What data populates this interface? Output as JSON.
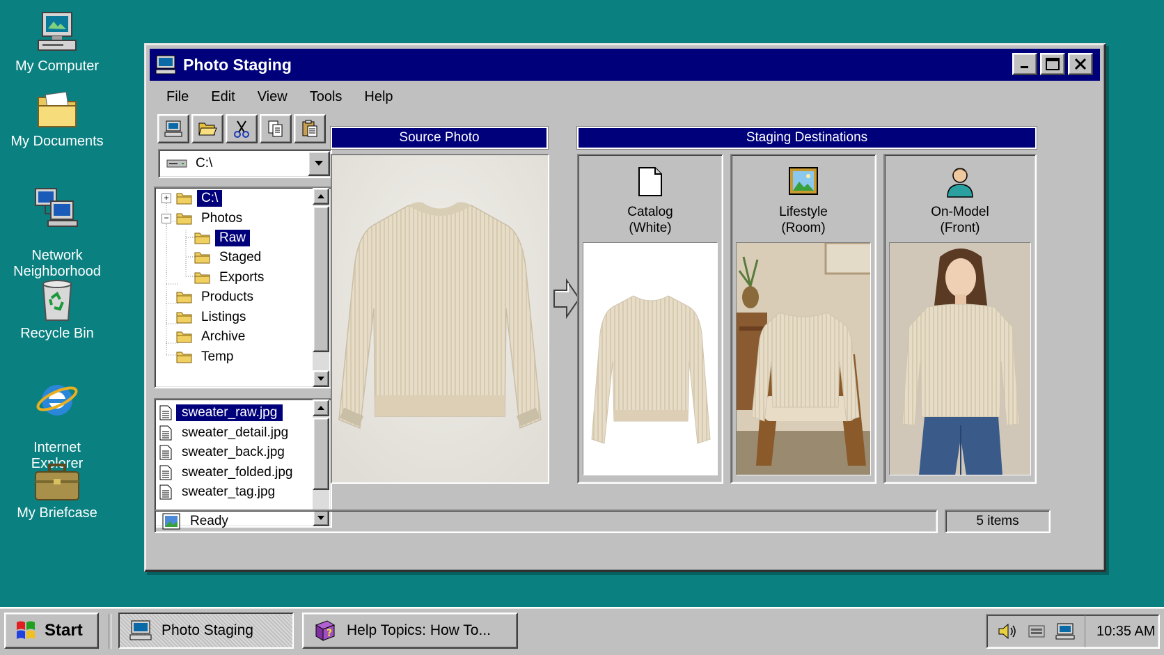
{
  "desktop": {
    "icons": [
      {
        "id": "my-computer",
        "label": "My Computer"
      },
      {
        "id": "my-documents",
        "label": "My Documents"
      },
      {
        "id": "network",
        "label": "Network\nNeighborhood"
      },
      {
        "id": "recycle-bin",
        "label": "Recycle Bin"
      },
      {
        "id": "internet-explorer",
        "label": "Internet\nExplorer"
      },
      {
        "id": "my-briefcase",
        "label": "My Briefcase"
      }
    ]
  },
  "window": {
    "title": "Photo Staging",
    "menu": [
      "File",
      "Edit",
      "View",
      "Tools",
      "Help"
    ],
    "toolbar": [
      {
        "icon": "computer-icon"
      },
      {
        "icon": "open-folder-icon"
      },
      {
        "icon": "cut-icon"
      },
      {
        "icon": "copy-icon"
      },
      {
        "icon": "paste-icon"
      }
    ],
    "drive": {
      "value": "C:\\"
    },
    "tree": [
      {
        "label": "C:\\",
        "level": 0,
        "expander": "+",
        "selected": true
      },
      {
        "label": "Photos",
        "level": 0,
        "expander": "-",
        "selected": false
      },
      {
        "label": "Raw",
        "level": 1,
        "expander": "",
        "selected": true
      },
      {
        "label": "Staged",
        "level": 1,
        "expander": "",
        "selected": false
      },
      {
        "label": "Exports",
        "level": 1,
        "expander": "",
        "selected": false
      },
      {
        "label": "Products",
        "level": 0,
        "expander": "",
        "selected": false
      },
      {
        "label": "Listings",
        "level": 0,
        "expander": "",
        "selected": false
      },
      {
        "label": "Archive",
        "level": 0,
        "expander": "",
        "selected": false
      },
      {
        "label": "Temp",
        "level": 0,
        "expander": "",
        "selected": false
      }
    ],
    "files": [
      {
        "name": "sweater_raw.jpg",
        "selected": true
      },
      {
        "name": "sweater_detail.jpg",
        "selected": false
      },
      {
        "name": "sweater_back.jpg",
        "selected": false
      },
      {
        "name": "sweater_folded.jpg",
        "selected": false
      },
      {
        "name": "sweater_tag.jpg",
        "selected": false
      }
    ],
    "source_header": "Source Photo",
    "destinations_header": "Staging Destinations",
    "destinations": [
      {
        "icon": "blank-page-icon",
        "line1": "Catalog",
        "line2": "(White)"
      },
      {
        "icon": "landscape-picture-icon",
        "line1": "Lifestyle",
        "line2": "(Room)"
      },
      {
        "icon": "person-icon",
        "line1": "On-Model",
        "line2": "(Front)"
      }
    ],
    "status": {
      "text": "Ready",
      "count": "5 items"
    }
  },
  "taskbar": {
    "start_label": "Start",
    "tasks": [
      {
        "label": "Photo Staging",
        "active": true
      },
      {
        "label": "Help Topics: How To...",
        "active": false
      }
    ],
    "clock": "10:35 AM"
  },
  "colors": {
    "desktop": "#0a8080",
    "titlebar": "#00007b",
    "face": "#c0c0c0",
    "sweater": "#e8dfcd"
  }
}
